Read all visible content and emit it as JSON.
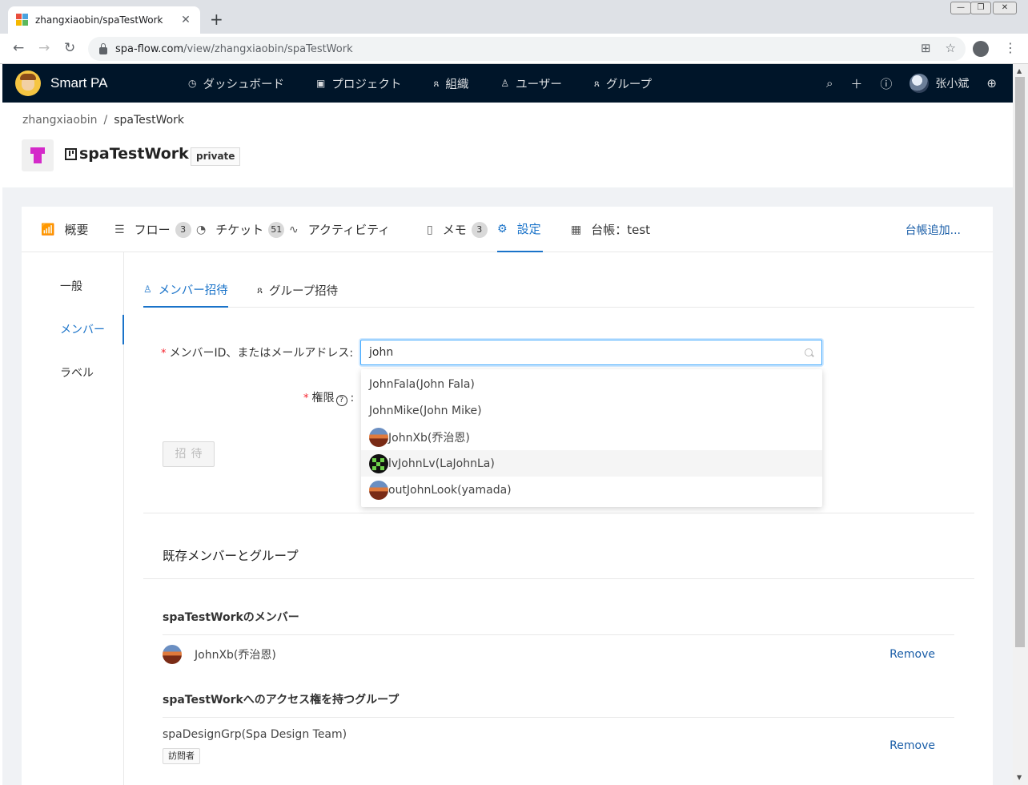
{
  "browser": {
    "tab_title": "zhangxiaobin/spaTestWork",
    "url_host": "spa-flow.com",
    "url_path": "/view/zhangxiaobin/spaTestWork"
  },
  "app": {
    "name": "Smart PA",
    "nav": [
      {
        "label": "ダッシュボード",
        "icon": "dashboard-icon"
      },
      {
        "label": "プロジェクト",
        "icon": "project-icon"
      },
      {
        "label": "組織",
        "icon": "organization-icon"
      },
      {
        "label": "ユーザー",
        "icon": "user-icon"
      },
      {
        "label": "グループ",
        "icon": "group-icon"
      }
    ],
    "user_name": "张小斌"
  },
  "breadcrumb": {
    "owner": "zhangxiaobin",
    "separator": "/",
    "repo": "spaTestWork"
  },
  "repo": {
    "title": "spaTestWork",
    "visibility": "private"
  },
  "project_tabs": [
    {
      "label": "概要",
      "icon": "chart-icon"
    },
    {
      "label": "フロー",
      "icon": "flow-icon",
      "count": "3"
    },
    {
      "label": "チケット",
      "icon": "ticket-icon",
      "count": "51"
    },
    {
      "label": "アクティビティ",
      "icon": "activity-icon"
    },
    {
      "label": "メモ",
      "icon": "memo-icon",
      "count": "3"
    },
    {
      "label": "設定",
      "icon": "settings-icon"
    },
    {
      "label": "台帳：test",
      "icon": "table-icon"
    }
  ],
  "add_ledger": "台帳追加...",
  "side_menu": [
    "一般",
    "メンバー",
    "ラベル"
  ],
  "sub_tabs": [
    "メンバー招待",
    "グループ招待"
  ],
  "form": {
    "member_label": "メンバーID、またはメールアドレス:",
    "member_value": "john",
    "permission_label": "権限",
    "permission_colon": ":",
    "invite_button": "招待"
  },
  "dropdown_options": [
    {
      "label": "JohnFala(John Fala)",
      "avatar": "none"
    },
    {
      "label": "JohnMike(John Mike)",
      "avatar": "none"
    },
    {
      "label": "JohnXb(乔治恩)",
      "avatar": "landscape"
    },
    {
      "label": "lvJohnLv(LaJohnLa)",
      "avatar": "pixel"
    },
    {
      "label": "outJohnLook(yamada)",
      "avatar": "landscape"
    }
  ],
  "existing": {
    "title": "既存メンバーとグループ",
    "members_heading": "spaTestWorkのメンバー",
    "members": [
      {
        "name": "JohnXb(乔治恩)",
        "remove": "Remove"
      }
    ],
    "groups_heading": "spaTestWorkへのアクセス権を持つグループ",
    "groups": [
      {
        "name": "spaDesignGrp(Spa Design Team)",
        "role": "訪問者",
        "remove": "Remove"
      }
    ]
  }
}
